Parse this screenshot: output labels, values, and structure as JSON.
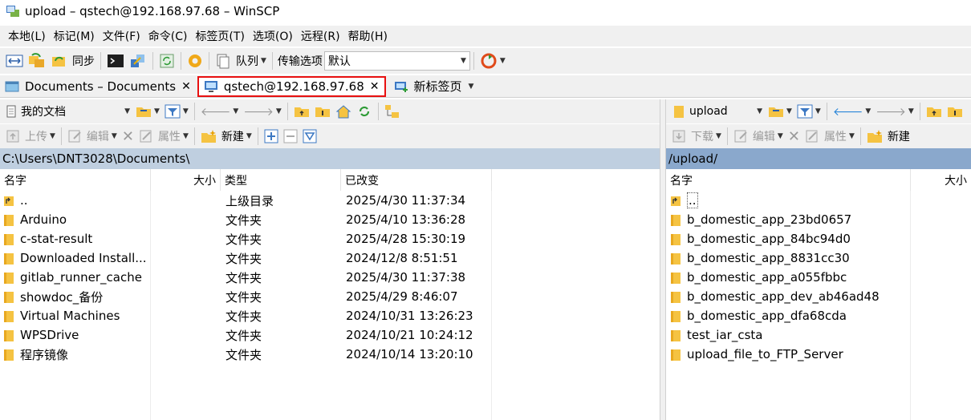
{
  "window": {
    "title": "upload – qstech@192.168.97.68 – WinSCP"
  },
  "menu": [
    "本地(L)",
    "标记(M)",
    "文件(F)",
    "命令(C)",
    "标签页(T)",
    "选项(O)",
    "远程(R)",
    "帮助(H)"
  ],
  "toolbar": {
    "sync_label": "同步",
    "queue_label": "队列",
    "transfer_label": "传输选项",
    "transfer_value": "默认"
  },
  "tabs": [
    {
      "label": "Documents – Documents"
    },
    {
      "label": "qstech@192.168.97.68"
    },
    {
      "label": "新标签页"
    }
  ],
  "left": {
    "location": "我的文档",
    "actions": {
      "upload": "上传",
      "edit": "编辑",
      "properties": "属性",
      "new": "新建"
    },
    "path": "C:\\Users\\DNT3028\\Documents\\",
    "columns": {
      "name": "名字",
      "size": "大小",
      "type": "类型",
      "changed": "已改变"
    },
    "files": [
      {
        "name": "..",
        "type": "上级目录",
        "changed": "2025/4/30 11:37:34"
      },
      {
        "name": "Arduino",
        "type": "文件夹",
        "changed": "2025/4/10 13:36:28"
      },
      {
        "name": "c-stat-result",
        "type": "文件夹",
        "changed": "2025/4/28 15:30:19"
      },
      {
        "name": "Downloaded Install...",
        "type": "文件夹",
        "changed": "2024/12/8 8:51:51"
      },
      {
        "name": "gitlab_runner_cache",
        "type": "文件夹",
        "changed": "2025/4/30 11:37:38"
      },
      {
        "name": "showdoc_备份",
        "type": "文件夹",
        "changed": "2025/4/29 8:46:07"
      },
      {
        "name": "Virtual Machines",
        "type": "文件夹",
        "changed": "2024/10/31 13:26:23"
      },
      {
        "name": "WPSDrive",
        "type": "文件夹",
        "changed": "2024/10/21 10:24:12"
      },
      {
        "name": "程序镜像",
        "type": "文件夹",
        "changed": "2024/10/14 13:20:10"
      }
    ]
  },
  "right": {
    "location": "upload",
    "actions": {
      "download": "下载",
      "edit": "编辑",
      "properties": "属性",
      "new": "新建"
    },
    "path": "/upload/",
    "columns": {
      "name": "名字",
      "size": "大小"
    },
    "files": [
      {
        "name": ".."
      },
      {
        "name": "b_domestic_app_23bd0657"
      },
      {
        "name": "b_domestic_app_84bc94d0"
      },
      {
        "name": "b_domestic_app_8831cc30"
      },
      {
        "name": "b_domestic_app_a055fbbc"
      },
      {
        "name": "b_domestic_app_dev_ab46ad48"
      },
      {
        "name": "b_domestic_app_dfa68cda"
      },
      {
        "name": "test_iar_csta"
      },
      {
        "name": "upload_file_to_FTP_Server"
      }
    ]
  },
  "colors": {
    "folder": "#f5c342",
    "active_tab_border": "#e81010",
    "left_path_bg": "#bfcfe0",
    "right_path_bg": "#8aa8cc"
  }
}
